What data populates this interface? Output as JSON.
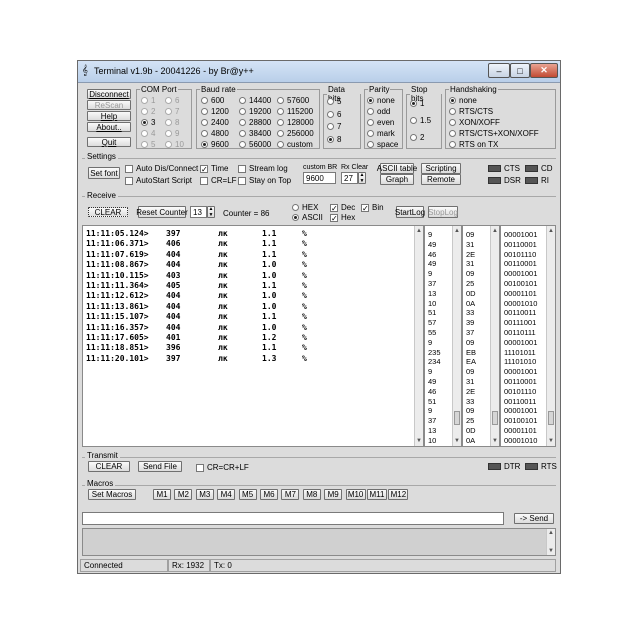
{
  "window": {
    "title": "Terminal v1.9b - 20041226 - by Br@y++",
    "controls": [
      "minimize",
      "maximize",
      "close"
    ]
  },
  "connection_buttons": {
    "disconnect": "Disconnect",
    "rescan": "ReScan",
    "help": "Help",
    "about": "About..",
    "quit": "Quit"
  },
  "com_port": {
    "title": "COM Port",
    "options": [
      "1",
      "2",
      "3",
      "4",
      "5",
      "6",
      "7",
      "8",
      "9",
      "10"
    ],
    "selected": "3"
  },
  "baud_rate": {
    "title": "Baud rate",
    "options": [
      "600",
      "1200",
      "2400",
      "4800",
      "9600",
      "14400",
      "19200",
      "28800",
      "38400",
      "56000",
      "57600",
      "115200",
      "128000",
      "256000",
      "custom"
    ],
    "selected": "9600"
  },
  "data_bits": {
    "title": "Data bits",
    "options": [
      "5",
      "6",
      "7",
      "8"
    ],
    "selected": "8"
  },
  "parity": {
    "title": "Parity",
    "options": [
      "none",
      "odd",
      "even",
      "mark",
      "space"
    ],
    "selected": "none"
  },
  "stop_bits": {
    "title": "Stop bits",
    "options": [
      "1",
      "1.5",
      "2"
    ],
    "selected": "1"
  },
  "handshaking": {
    "title": "Handshaking",
    "options": [
      "none",
      "RTS/CTS",
      "XON/XOFF",
      "RTS/CTS+XON/XOFF",
      "RTS on TX"
    ],
    "selected": "none"
  },
  "settings": {
    "title": "Settings",
    "set_font": "Set font",
    "auto_dis_connect": "Auto Dis/Connect",
    "autostart_script": "AutoStart Script",
    "time": "Time",
    "cr_lf": "CR=LF",
    "stream_log": "Stream log",
    "stay_on_top": "Stay on Top",
    "custom_br_label": "custom BR",
    "custom_br_value": "9600",
    "rx_clear_label": "Rx Clear",
    "rx_clear_value": "27",
    "ascii_table": "ASCII table",
    "graph": "Graph",
    "scripting": "Scripting",
    "remote": "Remote",
    "leds": [
      "CTS",
      "CD",
      "DSR",
      "RI"
    ]
  },
  "receive": {
    "title": "Receive",
    "clear": "CLEAR",
    "reset_counter": "Reset Counter",
    "counter_spin": "13",
    "counter_text": "Counter = 86",
    "hex": "HEX",
    "ascii": "ASCII",
    "dec": "Dec",
    "hex_check": "Hex",
    "bin": "Bin",
    "start_log": "StartLog",
    "stop_log": "StopLog",
    "log_rows": [
      {
        "time": "11:11:05.124>",
        "value": "397",
        "text": "лк",
        "num": "1.1",
        "pct": "%"
      },
      {
        "time": "11:11:06.371>",
        "value": "406",
        "text": "лк",
        "num": "1.1",
        "pct": "%"
      },
      {
        "time": "11:11:07.619>",
        "value": "404",
        "text": "лк",
        "num": "1.1",
        "pct": "%"
      },
      {
        "time": "11:11:08.867>",
        "value": "404",
        "text": "лк",
        "num": "1.0",
        "pct": "%"
      },
      {
        "time": "11:11:10.115>",
        "value": "403",
        "text": "лк",
        "num": "1.0",
        "pct": "%"
      },
      {
        "time": "11:11:11.364>",
        "value": "405",
        "text": "лк",
        "num": "1.1",
        "pct": "%"
      },
      {
        "time": "11:11:12.612>",
        "value": "404",
        "text": "лк",
        "num": "1.0",
        "pct": "%"
      },
      {
        "time": "11:11:13.861>",
        "value": "404",
        "text": "лк",
        "num": "1.0",
        "pct": "%"
      },
      {
        "time": "11:11:15.107>",
        "value": "404",
        "text": "лк",
        "num": "1.1",
        "pct": "%"
      },
      {
        "time": "11:11:16.357>",
        "value": "404",
        "text": "лк",
        "num": "1.0",
        "pct": "%"
      },
      {
        "time": "11:11:17.605>",
        "value": "401",
        "text": "лк",
        "num": "1.2",
        "pct": "%"
      },
      {
        "time": "11:11:18.851>",
        "value": "396",
        "text": "лк",
        "num": "1.1",
        "pct": "%"
      },
      {
        "time": "11:11:20.101>",
        "value": "397",
        "text": "лк",
        "num": "1.3",
        "pct": "%"
      }
    ],
    "dec_column": [
      "9",
      "49",
      "46",
      "49",
      "9",
      "37",
      "13",
      "10",
      "51",
      "57",
      "55",
      "9",
      "235",
      "234",
      "9",
      "49",
      "46",
      "51",
      "9",
      "37",
      "13",
      "10"
    ],
    "hex_column": [
      "09",
      "31",
      "2E",
      "31",
      "09",
      "25",
      "0D",
      "0A",
      "33",
      "39",
      "37",
      "09",
      "EB",
      "EA",
      "09",
      "31",
      "2E",
      "33",
      "09",
      "25",
      "0D",
      "0A"
    ],
    "bin_column": [
      "00001001",
      "00110001",
      "00101110",
      "00110001",
      "00001001",
      "00100101",
      "00001101",
      "00001010",
      "00110011",
      "00111001",
      "00110111",
      "00001001",
      "11101011",
      "11101010",
      "00001001",
      "00110001",
      "00101110",
      "00110011",
      "00001001",
      "00100101",
      "00001101",
      "00001010"
    ]
  },
  "transmit": {
    "title": "Transmit",
    "clear": "CLEAR",
    "send_file": "Send File",
    "cr_cr_lf": "CR=CR+LF",
    "leds": [
      "DTR",
      "RTS"
    ]
  },
  "macros": {
    "title": "Macros",
    "set_macros": "Set Macros",
    "buttons": [
      "M1",
      "M2",
      "M3",
      "M4",
      "M5",
      "M6",
      "M7",
      "M8",
      "M9",
      "M10",
      "M11",
      "M12"
    ],
    "send": "-> Send",
    "input_value": ""
  },
  "status": {
    "connection": "Connected",
    "rx": "Rx: 1932",
    "tx": "Tx: 0"
  },
  "watermark": "www.bugsec.com"
}
